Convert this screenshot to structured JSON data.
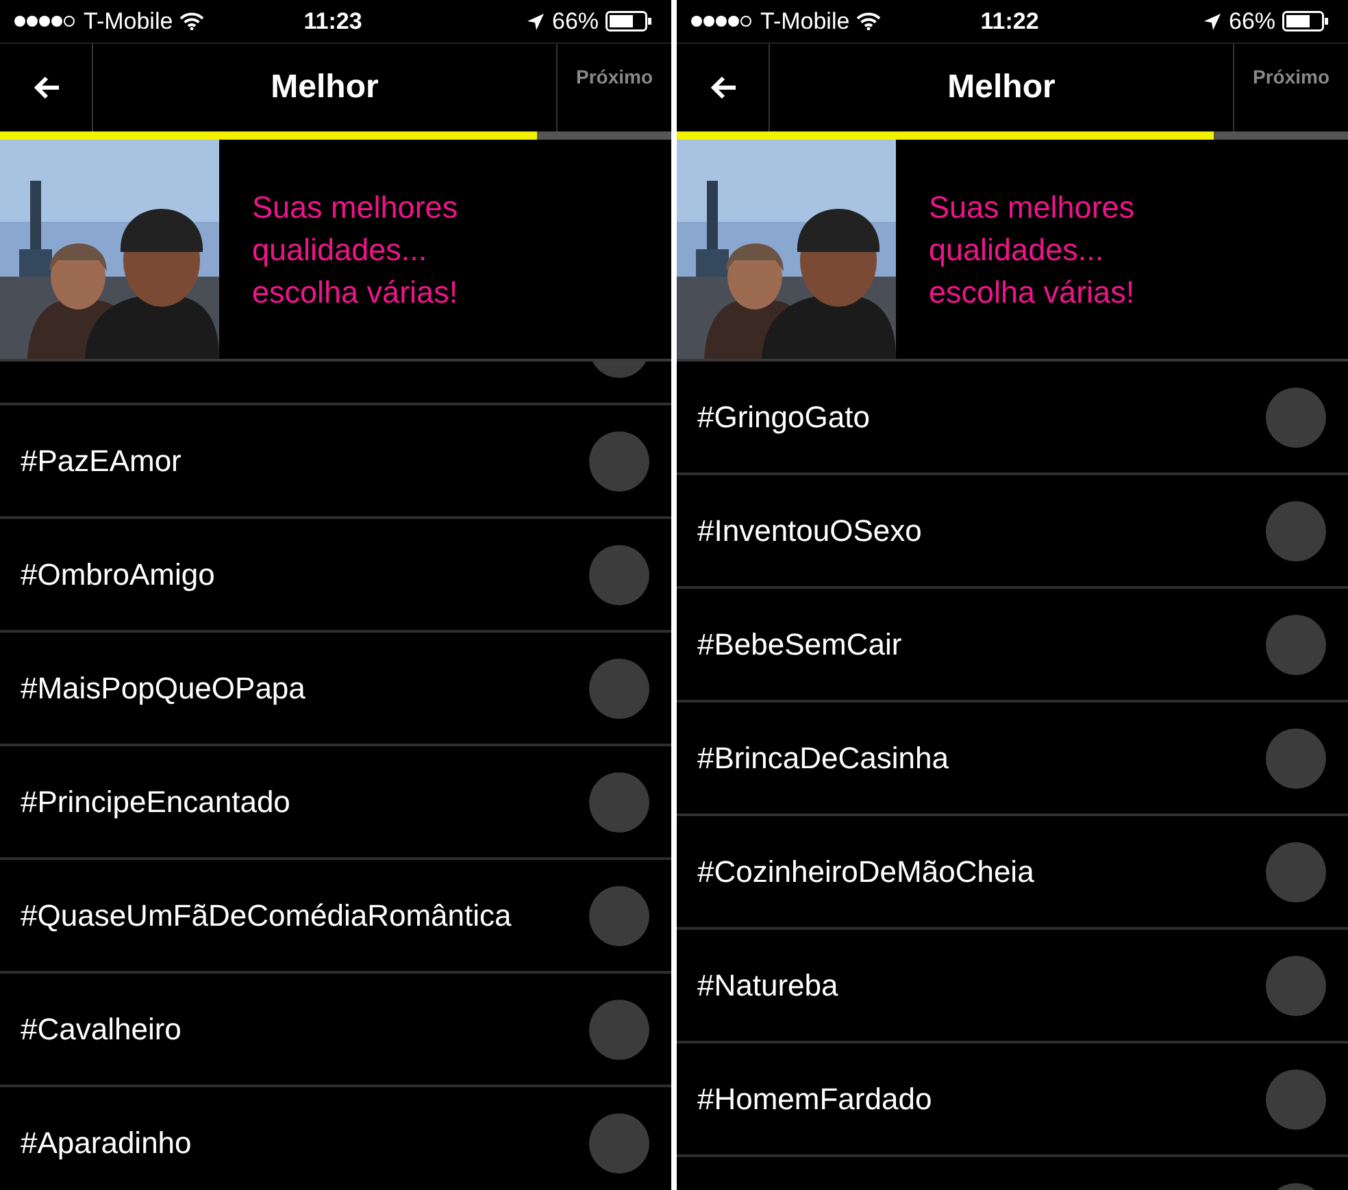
{
  "screens": [
    {
      "status_bar": {
        "carrier": "T-Mobile",
        "time": "11:23",
        "battery": "66%"
      },
      "header": {
        "title": "Melhor",
        "next": "Próximo"
      },
      "progress": {
        "level": 0.8
      },
      "banner": {
        "text": "Suas melhores qualidades... escolha várias!"
      },
      "items": [
        {
          "checked": false
        },
        {
          "label": "#PazEAmor",
          "checked": false
        },
        {
          "label": "#OmbroAmigo",
          "checked": false
        },
        {
          "label": "#MaisPopQueOPapa",
          "checked": false
        },
        {
          "label": "#PrincipeEncantado",
          "checked": false
        },
        {
          "label": "#QuaseUmFãDeComédiaRomântica",
          "checked": false
        },
        {
          "label": "#Cavalheiro",
          "checked": false
        },
        {
          "label": "#Aparadinho",
          "checked": false
        }
      ]
    },
    {
      "status_bar": {
        "carrier": "T-Mobile",
        "time": "11:22",
        "battery": "66%"
      },
      "header": {
        "title": "Melhor",
        "next": "Próximo"
      },
      "progress": {
        "level": 0.8
      },
      "banner": {
        "text": "Suas melhores qualidades... escolha várias!"
      },
      "items": [
        {
          "label": "#GringoGato",
          "checked": false
        },
        {
          "label": "#InventouOSexo",
          "checked": false
        },
        {
          "label": "#BebeSemCair",
          "checked": false
        },
        {
          "label": "#BrincaDeCasinha",
          "checked": false
        },
        {
          "label": "#CozinheiroDeMãoCheia",
          "checked": false
        },
        {
          "label": "#Natureba",
          "checked": false
        },
        {
          "label": "#HomemFardado",
          "checked": false
        },
        {
          "checked": false
        }
      ]
    }
  ]
}
